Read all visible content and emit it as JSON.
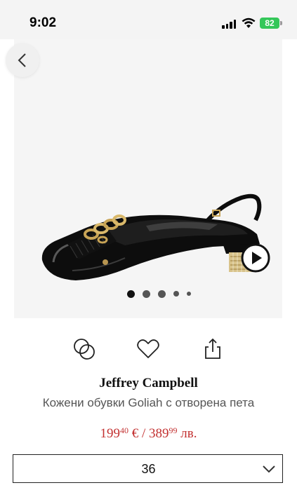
{
  "status_bar": {
    "time": "9:02",
    "battery": "82"
  },
  "gallery": {
    "image_alt": "Black patent slingback shoe with gold chain",
    "image_count": 5,
    "active_index": 0
  },
  "product": {
    "brand": "Jeffrey Campbell",
    "name": "Кожени обувки Goliah с отворена пета",
    "price_eur_main": "199",
    "price_eur_cents": "40",
    "price_eur_suffix": " € / ",
    "price_bgn_main": "389",
    "price_bgn_cents": "99",
    "price_bgn_suffix": " лв."
  },
  "size_selector": {
    "value": "36"
  },
  "icons": [
    "chevron-left-icon",
    "play-icon",
    "compare-icon",
    "heart-icon",
    "share-icon",
    "chevron-down-icon"
  ],
  "colors": {
    "price": "#c33131",
    "battery": "#34c759",
    "gallery_bg": "#f5f5f5"
  }
}
